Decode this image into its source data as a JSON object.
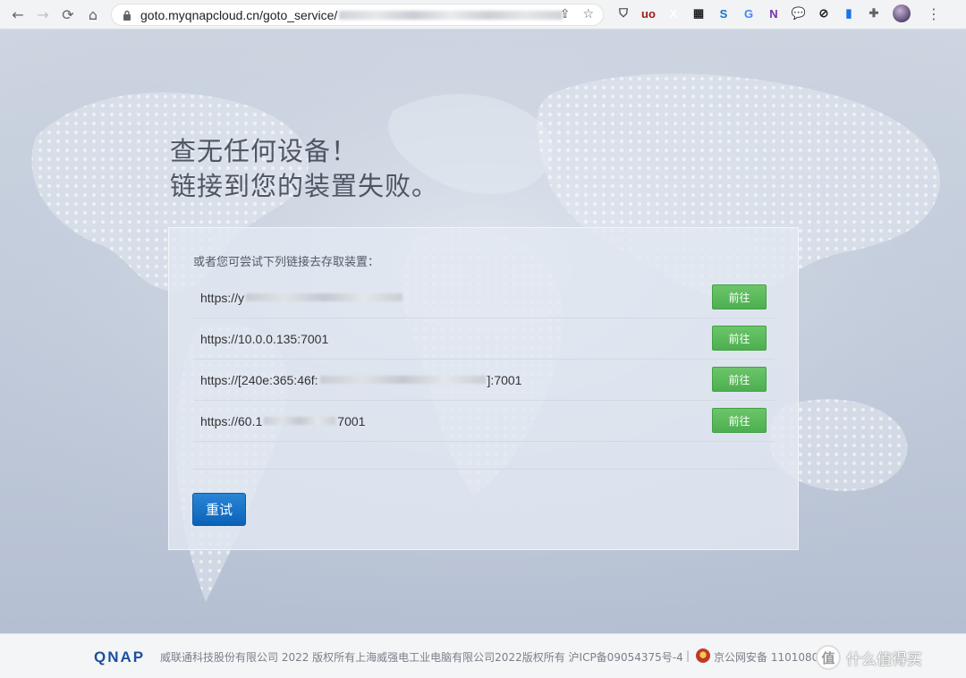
{
  "browser": {
    "url_visible": "goto.myqnapcloud.cn/goto_service/",
    "nav": {
      "back": "←",
      "forward": "→",
      "reload": "⟳",
      "home": "⌂"
    },
    "extensions": [
      {
        "name": "shield-extension",
        "glyph": "⛉",
        "color": "#3c4043"
      },
      {
        "name": "ublock-extension",
        "glyph": "uo",
        "color": "#a01a1a"
      },
      {
        "name": "x-extension",
        "glyph": "X",
        "color": "#ffffff"
      },
      {
        "name": "qr-extension",
        "glyph": "▦",
        "color": "#202124"
      },
      {
        "name": "s-extension",
        "glyph": "S",
        "color": "#1a73c8"
      },
      {
        "name": "translate-extension",
        "glyph": "G",
        "color": "#4285f4"
      },
      {
        "name": "onenote-extension",
        "glyph": "N",
        "color": "#7b2fb5"
      },
      {
        "name": "chat-extension",
        "glyph": "💬",
        "color": "#1a9cf0"
      },
      {
        "name": "block-extension",
        "glyph": "⊘",
        "color": "#202124"
      },
      {
        "name": "bookmark-extension",
        "glyph": "▮",
        "color": "#1a73e8"
      },
      {
        "name": "puzzle-extension",
        "glyph": "✚",
        "color": "#5f6368"
      }
    ]
  },
  "page": {
    "headline_line1": "查无任何设备！",
    "headline_line2": "链接到您的装置失败。",
    "hint": "或者您可尝试下列链接去存取装置：",
    "links": [
      {
        "prefix": "https://y",
        "suffix": "",
        "blur_width": 175
      },
      {
        "prefix": "https://10.0.0.135:7001",
        "suffix": "",
        "blur_width": 0
      },
      {
        "prefix": "https://[240e:365:46f:",
        "suffix": "]:7001",
        "blur_width": 185
      },
      {
        "prefix": "https://60.1",
        "suffix": " 7001",
        "blur_width": 80
      }
    ],
    "go_label": "前往",
    "retry_label": "重试"
  },
  "footer": {
    "logo": "QNAP",
    "copyright": "威联通科技股份有限公司 2022 版权所有上海威强电工业电脑有限公司2022版权所有 沪ICP备09054375号-4",
    "separator": "|",
    "beian": "京公网安备 1101080",
    "watermark_badge": "值",
    "watermark_text": "什么值得买"
  },
  "colors": {
    "go_button": "#4caf50",
    "retry_button": "#0b62b8",
    "headline": "#4f5663"
  }
}
